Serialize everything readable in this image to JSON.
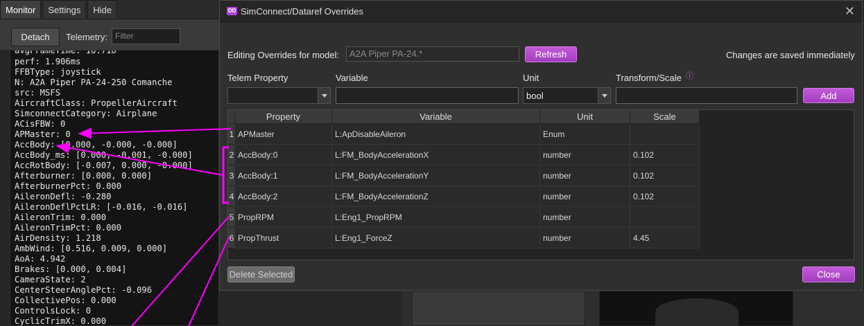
{
  "bg": {
    "tabs": [
      "Monitor",
      "Settings",
      "Hide"
    ],
    "detach_label": "Detach",
    "telemetry_label": "Telemetry:",
    "filter_placeholder": "Filter",
    "lines": [
      "avgFrameTime: 16.718",
      "perf: 1.906ms",
      "FFBType: joystick",
      "N: A2A Piper PA-24-250 Comanche",
      "src: MSFS",
      "AircraftClass: PropellerAircraft",
      "SimconnectCategory: Airplane",
      "ACisFBW: 0",
      "APMaster: 0",
      "AccBody: [0.000, -0.000, -0.000]",
      "AccBody_ms: [0.000, -0.001, -0.000]",
      "AccRotBody: [-0.007, 0.000, -0.000]",
      "Afterburner: [0.000, 0.000]",
      "AfterburnerPct: 0.000",
      "AileronDefl: -0.280",
      "AileronDeflPctLR: [-0.016, -0.016]",
      "AileronTrim: 0.000",
      "AileronTrimPct: 0.000",
      "AirDensity: 1.218",
      "AmbWind: [0.516, 0.009, 0.000]",
      "AoA: 4.942",
      "Brakes: [0.000, 0.004]",
      "CameraState: 2",
      "CenterSteerAnglePct: -0.096",
      "CollectivePos: 0.000",
      "ControlsLock: 0",
      "CyclicTrimX: 0.000"
    ]
  },
  "dialog": {
    "logo_text": "ŊŊ",
    "title": "SimConnect/Dataref Overrides",
    "editing_label": "Editing Overrides for model:",
    "model_value": "A2A Piper PA-24.*",
    "refresh_label": "Refresh",
    "saved_note": "Changes are saved immediately",
    "col_telem": "Telem Property",
    "col_variable": "Variable",
    "col_unit": "Unit",
    "col_transform": "Transform/Scale",
    "unit_value": "bool",
    "add_label": "Add",
    "table": {
      "headers": [
        "Property",
        "Variable",
        "Unit",
        "Scale"
      ],
      "rows": [
        {
          "n": "1",
          "property": "APMaster",
          "variable": "L:ApDisableAileron",
          "unit": "Enum",
          "scale": ""
        },
        {
          "n": "2",
          "property": "AccBody:0",
          "variable": "L:FM_BodyAccelerationX",
          "unit": "number",
          "scale": "0.102"
        },
        {
          "n": "3",
          "property": "AccBody:1",
          "variable": "L:FM_BodyAccelerationY",
          "unit": "number",
          "scale": "0.102"
        },
        {
          "n": "4",
          "property": "AccBody:2",
          "variable": "L:FM_BodyAccelerationZ",
          "unit": "number",
          "scale": "0.102"
        },
        {
          "n": "5",
          "property": "PropRPM",
          "variable": "L:Eng1_PropRPM",
          "unit": "number",
          "scale": ""
        },
        {
          "n": "6",
          "property": "PropThrust",
          "variable": "L:Eng1_ForceZ",
          "unit": "number",
          "scale": "4.45"
        }
      ]
    },
    "delete_label": "Delete Selected",
    "close_label": "Close"
  },
  "colors": {
    "accent": "#b040e0",
    "annotation": "#ff00ff"
  }
}
